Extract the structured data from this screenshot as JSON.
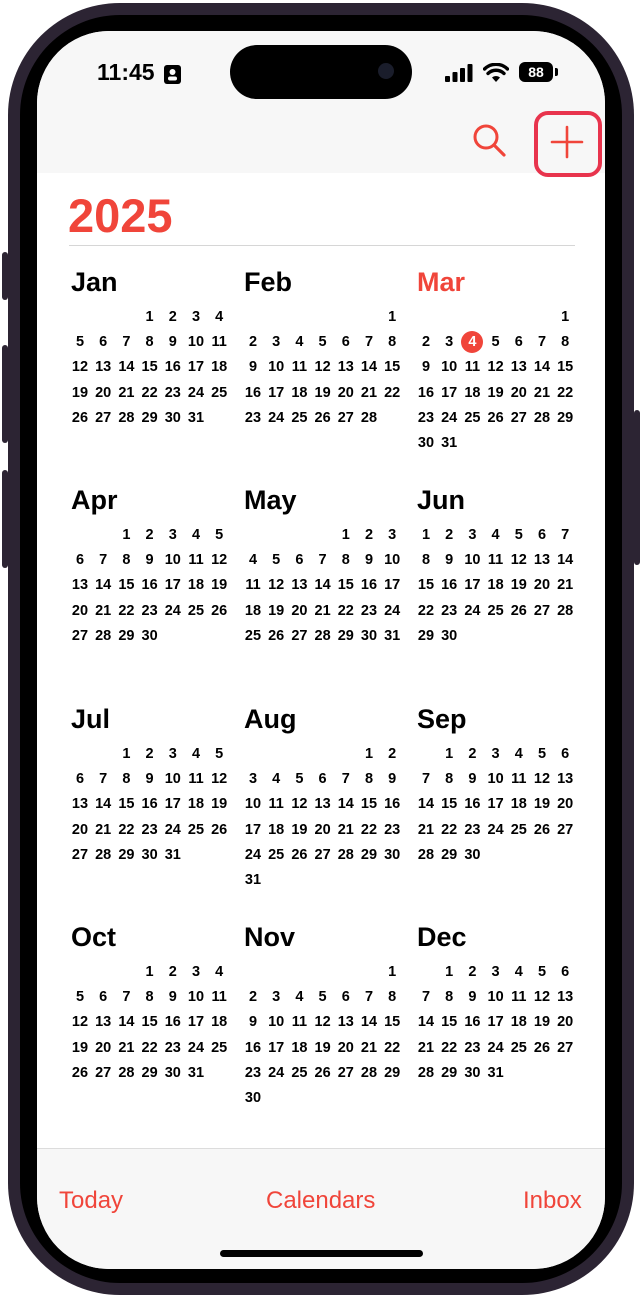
{
  "status_bar": {
    "time": "11:45",
    "battery": "88"
  },
  "toolbar": {
    "search_icon": "search-icon",
    "add_icon": "plus-icon",
    "highlight_color": "#e8344d"
  },
  "year": "2025",
  "accent_color": "#f0453a",
  "months": [
    {
      "name": "Jan",
      "start": 3,
      "days": [
        "1",
        "2",
        "3",
        "4",
        "5",
        "6",
        "7",
        "8",
        "9",
        "10",
        "11",
        "12",
        "13",
        "14",
        "15",
        "16",
        "17",
        "18",
        "19",
        "20",
        "21",
        "22",
        "23",
        "24",
        "25",
        "26",
        "27",
        "28",
        "29",
        "30",
        "31"
      ]
    },
    {
      "name": "Feb",
      "start": 6,
      "days": [
        "1",
        "2",
        "3",
        "4",
        "5",
        "6",
        "7",
        "8",
        "9",
        "10",
        "11",
        "12",
        "13",
        "14",
        "15",
        "16",
        "17",
        "18",
        "19",
        "20",
        "21",
        "22",
        "23",
        "24",
        "25",
        "26",
        "27",
        "28"
      ]
    },
    {
      "name": "Mar",
      "start": 6,
      "current": true,
      "today": "4",
      "days": [
        "1",
        "2",
        "3",
        "4",
        "5",
        "6",
        "7",
        "8",
        "9",
        "10",
        "11",
        "12",
        "13",
        "14",
        "15",
        "16",
        "17",
        "18",
        "19",
        "20",
        "21",
        "22",
        "23",
        "24",
        "25",
        "26",
        "27",
        "28",
        "29",
        "30",
        "31"
      ]
    },
    {
      "name": "Apr",
      "start": 2,
      "days": [
        "1",
        "2",
        "3",
        "4",
        "5",
        "6",
        "7",
        "8",
        "9",
        "10",
        "11",
        "12",
        "13",
        "14",
        "15",
        "16",
        "17",
        "18",
        "19",
        "20",
        "21",
        "22",
        "23",
        "24",
        "25",
        "26",
        "27",
        "28",
        "29",
        "30"
      ]
    },
    {
      "name": "May",
      "start": 4,
      "days": [
        "1",
        "2",
        "3",
        "4",
        "5",
        "6",
        "7",
        "8",
        "9",
        "10",
        "11",
        "12",
        "13",
        "14",
        "15",
        "16",
        "17",
        "18",
        "19",
        "20",
        "21",
        "22",
        "23",
        "24",
        "25",
        "26",
        "27",
        "28",
        "29",
        "30",
        "31"
      ]
    },
    {
      "name": "Jun",
      "start": 0,
      "days": [
        "1",
        "2",
        "3",
        "4",
        "5",
        "6",
        "7",
        "8",
        "9",
        "10",
        "11",
        "12",
        "13",
        "14",
        "15",
        "16",
        "17",
        "18",
        "19",
        "20",
        "21",
        "22",
        "23",
        "24",
        "25",
        "26",
        "27",
        "28",
        "29",
        "30"
      ]
    },
    {
      "name": "Jul",
      "start": 2,
      "days": [
        "1",
        "2",
        "3",
        "4",
        "5",
        "6",
        "7",
        "8",
        "9",
        "10",
        "11",
        "12",
        "13",
        "14",
        "15",
        "16",
        "17",
        "18",
        "19",
        "20",
        "21",
        "22",
        "23",
        "24",
        "25",
        "26",
        "27",
        "28",
        "29",
        "30",
        "31"
      ]
    },
    {
      "name": "Aug",
      "start": 5,
      "days": [
        "1",
        "2",
        "3",
        "4",
        "5",
        "6",
        "7",
        "8",
        "9",
        "10",
        "11",
        "12",
        "13",
        "14",
        "15",
        "16",
        "17",
        "18",
        "19",
        "20",
        "21",
        "22",
        "23",
        "24",
        "25",
        "26",
        "27",
        "28",
        "29",
        "30",
        "31"
      ]
    },
    {
      "name": "Sep",
      "start": 1,
      "days": [
        "1",
        "2",
        "3",
        "4",
        "5",
        "6",
        "7",
        "8",
        "9",
        "10",
        "11",
        "12",
        "13",
        "14",
        "15",
        "16",
        "17",
        "18",
        "19",
        "20",
        "21",
        "22",
        "23",
        "24",
        "25",
        "26",
        "27",
        "28",
        "29",
        "30"
      ]
    },
    {
      "name": "Oct",
      "start": 3,
      "days": [
        "1",
        "2",
        "3",
        "4",
        "5",
        "6",
        "7",
        "8",
        "9",
        "10",
        "11",
        "12",
        "13",
        "14",
        "15",
        "16",
        "17",
        "18",
        "19",
        "20",
        "21",
        "22",
        "23",
        "24",
        "25",
        "26",
        "27",
        "28",
        "29",
        "30",
        "31"
      ]
    },
    {
      "name": "Nov",
      "start": 6,
      "days": [
        "1",
        "2",
        "3",
        "4",
        "5",
        "6",
        "7",
        "8",
        "9",
        "10",
        "11",
        "12",
        "13",
        "14",
        "15",
        "16",
        "17",
        "18",
        "19",
        "20",
        "21",
        "22",
        "23",
        "24",
        "25",
        "26",
        "27",
        "28",
        "29",
        "30"
      ]
    },
    {
      "name": "Dec",
      "start": 1,
      "days": [
        "1",
        "2",
        "3",
        "4",
        "5",
        "6",
        "7",
        "8",
        "9",
        "10",
        "11",
        "12",
        "13",
        "14",
        "15",
        "16",
        "17",
        "18",
        "19",
        "20",
        "21",
        "22",
        "23",
        "24",
        "25",
        "26",
        "27",
        "28",
        "29",
        "30",
        "31"
      ]
    }
  ],
  "tab_bar": {
    "today": "Today",
    "calendars": "Calendars",
    "inbox": "Inbox"
  }
}
